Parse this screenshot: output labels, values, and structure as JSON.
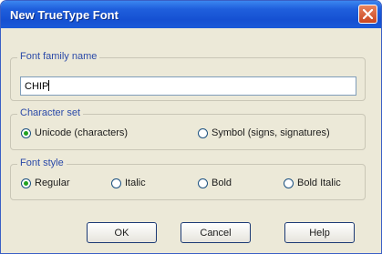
{
  "dialog": {
    "title": "New TrueType Font"
  },
  "font_family": {
    "legend": "Font family name",
    "value": "CHIP"
  },
  "character_set": {
    "legend": "Character set",
    "options": [
      {
        "label": "Unicode (characters)",
        "selected": true
      },
      {
        "label": "Symbol (signs, signatures)",
        "selected": false
      }
    ]
  },
  "font_style": {
    "legend": "Font style",
    "options": [
      {
        "label": "Regular",
        "selected": true
      },
      {
        "label": "Italic",
        "selected": false
      },
      {
        "label": "Bold",
        "selected": false
      },
      {
        "label": "Bold Italic",
        "selected": false
      }
    ]
  },
  "buttons": {
    "ok": "OK",
    "cancel": "Cancel",
    "help": "Help"
  },
  "icons": {
    "close": "close-icon"
  },
  "colors": {
    "titlebar": "#1f5fdc",
    "close": "#c94520",
    "radio_selected": "#21a121"
  }
}
